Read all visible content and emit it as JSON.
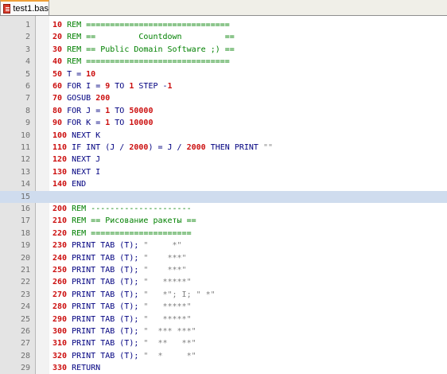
{
  "tab": {
    "title": "test1.bas",
    "icon": "basic-file-icon"
  },
  "lines": [
    {
      "n": "1",
      "tokens": [
        [
          "num",
          "10"
        ],
        [
          "kw",
          " "
        ],
        [
          "rem",
          "REM =============================="
        ]
      ]
    },
    {
      "n": "2",
      "tokens": [
        [
          "num",
          "20"
        ],
        [
          "kw",
          " "
        ],
        [
          "rem",
          "REM ==         Countdown         =="
        ]
      ]
    },
    {
      "n": "3",
      "tokens": [
        [
          "num",
          "30"
        ],
        [
          "kw",
          " "
        ],
        [
          "rem",
          "REM == Public Domain Software ;) =="
        ]
      ]
    },
    {
      "n": "4",
      "tokens": [
        [
          "num",
          "40"
        ],
        [
          "kw",
          " "
        ],
        [
          "rem",
          "REM =============================="
        ]
      ]
    },
    {
      "n": "5",
      "tokens": [
        [
          "num",
          "50"
        ],
        [
          "kw",
          " T = "
        ],
        [
          "num",
          "10"
        ]
      ]
    },
    {
      "n": "6",
      "tokens": [
        [
          "num",
          "60"
        ],
        [
          "kw",
          " FOR I = "
        ],
        [
          "num",
          "9"
        ],
        [
          "kw",
          " TO "
        ],
        [
          "num",
          "1"
        ],
        [
          "kw",
          " STEP -"
        ],
        [
          "num",
          "1"
        ]
      ]
    },
    {
      "n": "7",
      "tokens": [
        [
          "num",
          "70"
        ],
        [
          "kw",
          " GOSUB "
        ],
        [
          "num",
          "200"
        ]
      ]
    },
    {
      "n": "8",
      "tokens": [
        [
          "num",
          "80"
        ],
        [
          "kw",
          " FOR J = "
        ],
        [
          "num",
          "1"
        ],
        [
          "kw",
          " TO "
        ],
        [
          "num",
          "50000"
        ]
      ]
    },
    {
      "n": "9",
      "tokens": [
        [
          "num",
          "90"
        ],
        [
          "kw",
          " FOR K = "
        ],
        [
          "num",
          "1"
        ],
        [
          "kw",
          " TO "
        ],
        [
          "num",
          "10000"
        ]
      ]
    },
    {
      "n": "10",
      "tokens": [
        [
          "num",
          "100"
        ],
        [
          "kw",
          " NEXT K"
        ]
      ]
    },
    {
      "n": "11",
      "tokens": [
        [
          "num",
          "110"
        ],
        [
          "kw",
          " IF INT (J / "
        ],
        [
          "num",
          "2000"
        ],
        [
          "kw",
          ") = J / "
        ],
        [
          "num",
          "2000"
        ],
        [
          "kw",
          " THEN PRINT "
        ],
        [
          "str",
          "\"\""
        ]
      ]
    },
    {
      "n": "12",
      "tokens": [
        [
          "num",
          "120"
        ],
        [
          "kw",
          " NEXT J"
        ]
      ]
    },
    {
      "n": "13",
      "tokens": [
        [
          "num",
          "130"
        ],
        [
          "kw",
          " NEXT I"
        ]
      ]
    },
    {
      "n": "14",
      "tokens": [
        [
          "num",
          "140"
        ],
        [
          "kw",
          " END"
        ]
      ]
    },
    {
      "n": "15",
      "tokens": []
    },
    {
      "n": "16",
      "tokens": [
        [
          "num",
          "200"
        ],
        [
          "kw",
          " "
        ],
        [
          "rem",
          "REM ---------------------"
        ]
      ]
    },
    {
      "n": "17",
      "tokens": [
        [
          "num",
          "210"
        ],
        [
          "kw",
          " "
        ],
        [
          "rem",
          "REM == Рисование ракеты =="
        ]
      ]
    },
    {
      "n": "18",
      "tokens": [
        [
          "num",
          "220"
        ],
        [
          "kw",
          " "
        ],
        [
          "rem",
          "REM ====================="
        ]
      ]
    },
    {
      "n": "19",
      "tokens": [
        [
          "num",
          "230"
        ],
        [
          "kw",
          " PRINT TAB (T); "
        ],
        [
          "str",
          "\"     *\""
        ]
      ]
    },
    {
      "n": "20",
      "tokens": [
        [
          "num",
          "240"
        ],
        [
          "kw",
          " PRINT TAB (T); "
        ],
        [
          "str",
          "\"    ***\""
        ]
      ]
    },
    {
      "n": "21",
      "tokens": [
        [
          "num",
          "250"
        ],
        [
          "kw",
          " PRINT TAB (T); "
        ],
        [
          "str",
          "\"    ***\""
        ]
      ]
    },
    {
      "n": "22",
      "tokens": [
        [
          "num",
          "260"
        ],
        [
          "kw",
          " PRINT TAB (T); "
        ],
        [
          "str",
          "\"   *****\""
        ]
      ]
    },
    {
      "n": "23",
      "tokens": [
        [
          "num",
          "270"
        ],
        [
          "kw",
          " PRINT TAB (T); "
        ],
        [
          "str",
          "\"   *\"; I; \" *\""
        ]
      ]
    },
    {
      "n": "24",
      "tokens": [
        [
          "num",
          "280"
        ],
        [
          "kw",
          " PRINT TAB (T); "
        ],
        [
          "str",
          "\"   *****\""
        ]
      ]
    },
    {
      "n": "25",
      "tokens": [
        [
          "num",
          "290"
        ],
        [
          "kw",
          " PRINT TAB (T); "
        ],
        [
          "str",
          "\"   *****\""
        ]
      ]
    },
    {
      "n": "26",
      "tokens": [
        [
          "num",
          "300"
        ],
        [
          "kw",
          " PRINT TAB (T); "
        ],
        [
          "str",
          "\"  *** ***\""
        ]
      ]
    },
    {
      "n": "27",
      "tokens": [
        [
          "num",
          "310"
        ],
        [
          "kw",
          " PRINT TAB (T); "
        ],
        [
          "str",
          "\"  **   **\""
        ]
      ]
    },
    {
      "n": "28",
      "tokens": [
        [
          "num",
          "320"
        ],
        [
          "kw",
          " PRINT TAB (T); "
        ],
        [
          "str",
          "\"  *     *\""
        ]
      ]
    },
    {
      "n": "29",
      "tokens": [
        [
          "num",
          "330"
        ],
        [
          "kw",
          " RETURN"
        ]
      ]
    }
  ],
  "highlighted_line": "15",
  "colors": {
    "number": "#cc1010",
    "keyword": "#000080",
    "comment": "#008000",
    "string": "#808080",
    "current_line": "#cfdcee",
    "tab_accent": "#f0a038"
  }
}
